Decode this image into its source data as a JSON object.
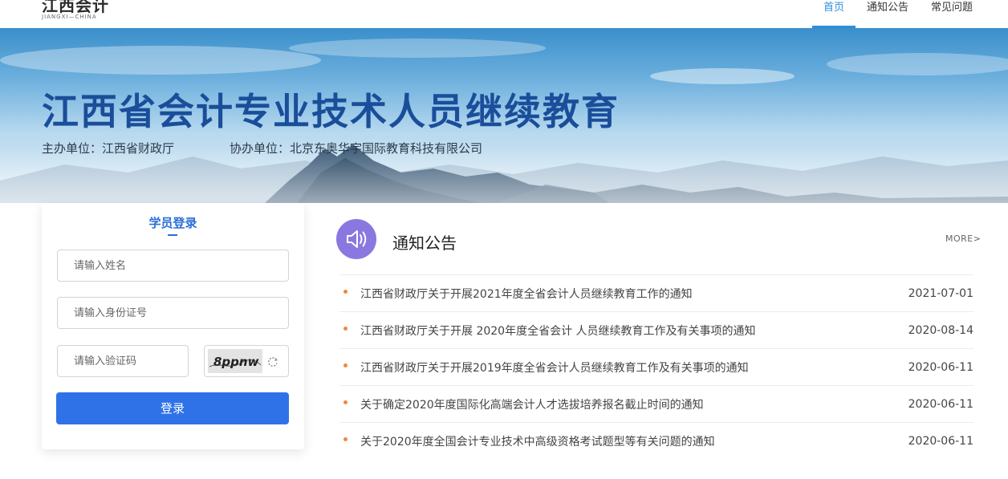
{
  "header": {
    "logo_cn": "江西会计",
    "logo_en": "JIANGXI—CHINA",
    "nav": [
      {
        "label": "首页",
        "active": true
      },
      {
        "label": "通知公告",
        "active": false
      },
      {
        "label": "常见问题",
        "active": false
      }
    ]
  },
  "banner": {
    "title": "江西省会计专业技术人员继续教育",
    "sponsor": "主办单位：江西省财政厅",
    "co_sponsor": "协办单位：北京东奥华宇国际教育科技有限公司"
  },
  "login": {
    "title": "学员登录",
    "name_placeholder": "请输入姓名",
    "id_placeholder": "请输入身份证号",
    "captcha_placeholder": "请输入验证码",
    "captcha_text": "8ppnw",
    "submit_label": "登录"
  },
  "notices": {
    "heading": "通知公告",
    "more_label": "MORE>",
    "items": [
      {
        "title": "江西省财政厅关于开展2021年度全省会计人员继续教育工作的通知",
        "date": "2021-07-01"
      },
      {
        "title": "江西省财政厅关于开展 2020年度全省会计 人员继续教育工作及有关事项的通知",
        "date": "2020-08-14"
      },
      {
        "title": "江西省财政厅关于开展2019年度全省会计人员继续教育工作及有关事项的通知",
        "date": "2020-06-11"
      },
      {
        "title": "关于确定2020年度国际化高端会计人才选拔培养报名截止时间的通知",
        "date": "2020-06-11"
      },
      {
        "title": "关于2020年度全国会计专业技术中高级资格考试题型等有关问题的通知",
        "date": "2020-06-11"
      }
    ]
  },
  "colors": {
    "accent": "#2b8fdc",
    "login_button": "#2f72e8",
    "banner_title": "#1a4e9a",
    "notice_icon_bg": "#8a78e0",
    "bullet": "#f0883c"
  },
  "icons": {
    "notice": "speaker-icon",
    "captcha_refresh": "refresh-icon"
  }
}
